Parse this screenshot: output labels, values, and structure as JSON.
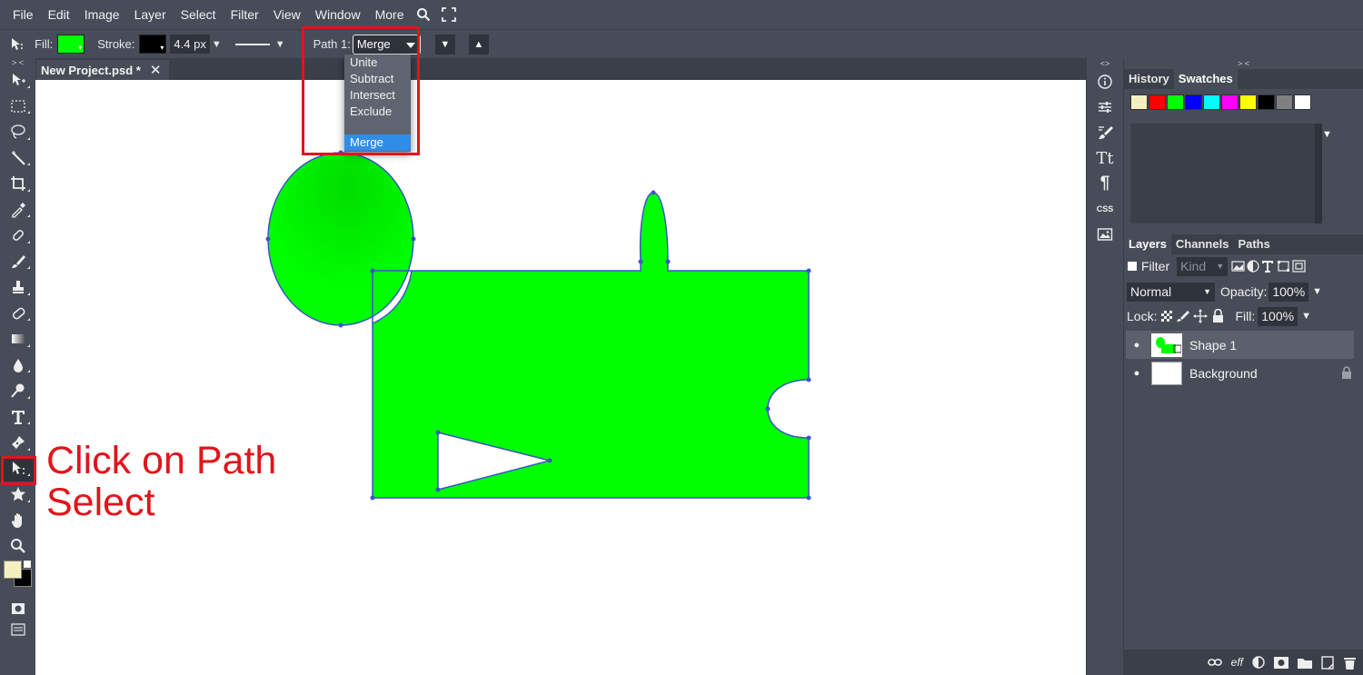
{
  "menubar": {
    "items": [
      "File",
      "Edit",
      "Image",
      "Layer",
      "Select",
      "Filter",
      "View",
      "Window",
      "More"
    ],
    "icons": [
      "search-icon",
      "fullscreen-icon"
    ]
  },
  "options": {
    "fill_label": "Fill:",
    "fill_color": "#00ff00",
    "stroke_label": "Stroke:",
    "stroke_color": "#000000",
    "stroke_width": "4.4 px",
    "path_label": "Path 1:",
    "path_op_value": "Merge",
    "down_label": "▼",
    "up_label": "▲"
  },
  "path_dropdown": {
    "options": [
      "Unite",
      "Subtract",
      "Intersect",
      "Exclude"
    ],
    "selected": "Merge"
  },
  "document": {
    "tab_title": "New Project.psd *",
    "close_glyph": "✕"
  },
  "annotation": {
    "line1": "Click on Path",
    "line2": "Select",
    "color": "#e2141b"
  },
  "toolbar": {
    "collapse": "> <",
    "tools": [
      "move-tool",
      "marquee-tool",
      "lasso-tool",
      "magic-wand-tool",
      "crop-tool",
      "eyedropper-tool",
      "healing-tool",
      "brush-tool",
      "stamp-tool",
      "eraser-tool",
      "gradient-tool",
      "blur-tool",
      "dodge-tool",
      "type-tool",
      "pen-tool",
      "path-select-tool",
      "shape-tool",
      "hand-tool",
      "zoom-tool"
    ],
    "foreground_color": "#f5f0c0",
    "background_color": "#000000"
  },
  "midstrip": {
    "collapse": "<>",
    "icons": [
      "info-icon",
      "adjustments-icon",
      "brush-settings-icon",
      "character-icon",
      "paragraph-icon",
      "css-icon",
      "image-icon"
    ],
    "character_glyph": "Tt",
    "paragraph_glyph": "¶",
    "css_text": "CSS"
  },
  "right_panel": {
    "collapse": "> <",
    "top_tabs": [
      "History",
      "Swatches"
    ],
    "swatch_colors": [
      "#f5f0c0",
      "#ff0000",
      "#00ff00",
      "#0000ff",
      "#00ffff",
      "#ff00ff",
      "#ffff00",
      "#000000",
      "#808080",
      "#ffffff"
    ],
    "history_arrow": "▼",
    "layer_tabs": [
      "Layers",
      "Channels",
      "Paths"
    ],
    "filter_label": "Filter",
    "kind_label": "Kind",
    "blend_mode": "Normal",
    "opacity_label": "Opacity:",
    "opacity_value": "100%",
    "lock_label": "Lock:",
    "fill_label": "Fill:",
    "fill_value": "100%",
    "layers": [
      {
        "name": "Shape 1",
        "selected": true
      },
      {
        "name": "Background",
        "selected": false
      }
    ],
    "bottom_icons": [
      "link-icon",
      "effects-icon",
      "adjustment-layer-icon",
      "mask-icon",
      "folder-icon",
      "new-layer-icon",
      "trash-icon"
    ],
    "eff_text": "eff"
  },
  "colors": {
    "ui_bg": "#474c58",
    "ui_dark": "#3b3f49",
    "accent_blue": "#2f8dea",
    "shape_green": "#00ff00",
    "path_blue": "#3a55c8"
  }
}
